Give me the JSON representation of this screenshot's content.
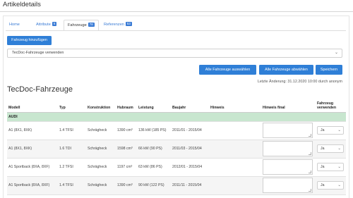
{
  "page": {
    "title": "Artikeldetails"
  },
  "tabs": [
    {
      "label": "Home",
      "badge": ""
    },
    {
      "label": "Attribute",
      "badge": "6"
    },
    {
      "label": "Fahrzeuge",
      "badge": "78"
    },
    {
      "label": "Referenzen",
      "badge": "53"
    }
  ],
  "actions": {
    "add_vehicle": "Fahrzeug hinzufügen",
    "select_all": "Alle Fahrzeuge auswählen",
    "deselect_all": "Alle Fahrzeuge abwählen",
    "save": "Speichern"
  },
  "source_select": {
    "value": "TecDoc-Fahrzeuge verwenden"
  },
  "last_change": "Letzte Änderung: 31.12.2020 10:00 durch anonym",
  "section_title": "TecDoc-Fahrzeuge",
  "table": {
    "headers": {
      "model": "Modell",
      "type": "Typ",
      "construction": "Konstruktion",
      "displacement": "Hubraum",
      "power": "Leistung",
      "year": "Baujahr",
      "hint": "Hinweis",
      "hint_final": "Hinweis final",
      "use": "Fahrzeug verwenden"
    },
    "group": "AUDI",
    "rows": [
      {
        "model": "A1 (8X1, 8XK)",
        "type": "1.4 TFSI",
        "construction": "Schrägheck",
        "displacement": "1390 cm³",
        "power": "136 kW (185 PS)",
        "year": "2011/01 - 2015/04",
        "hint": "",
        "use": "Ja"
      },
      {
        "model": "A1 (8X1, 8XK)",
        "type": "1.6 TDI",
        "construction": "Schrägheck",
        "displacement": "1598 cm³",
        "power": "66 kW (90 PS)",
        "year": "2011/03 - 2015/04",
        "hint": "",
        "use": "Ja"
      },
      {
        "model": "A1 Sportback (8XA, 8XF)",
        "type": "1.2 TFSI",
        "construction": "Schrägheck",
        "displacement": "1197 cm³",
        "power": "63 kW (86 PS)",
        "year": "2012/01 - 2015/04",
        "hint": "",
        "use": "Ja"
      },
      {
        "model": "A1 Sportback (8XA, 8XF)",
        "type": "1.4 TFSI",
        "construction": "Schrägheck",
        "displacement": "1390 cm³",
        "power": "90 kW (122 PS)",
        "year": "2011/11 - 2015/04",
        "hint": "",
        "use": "Ja"
      }
    ]
  },
  "colors": {
    "accent": "#2f7fd7",
    "group_row": "#c8e6cf"
  }
}
